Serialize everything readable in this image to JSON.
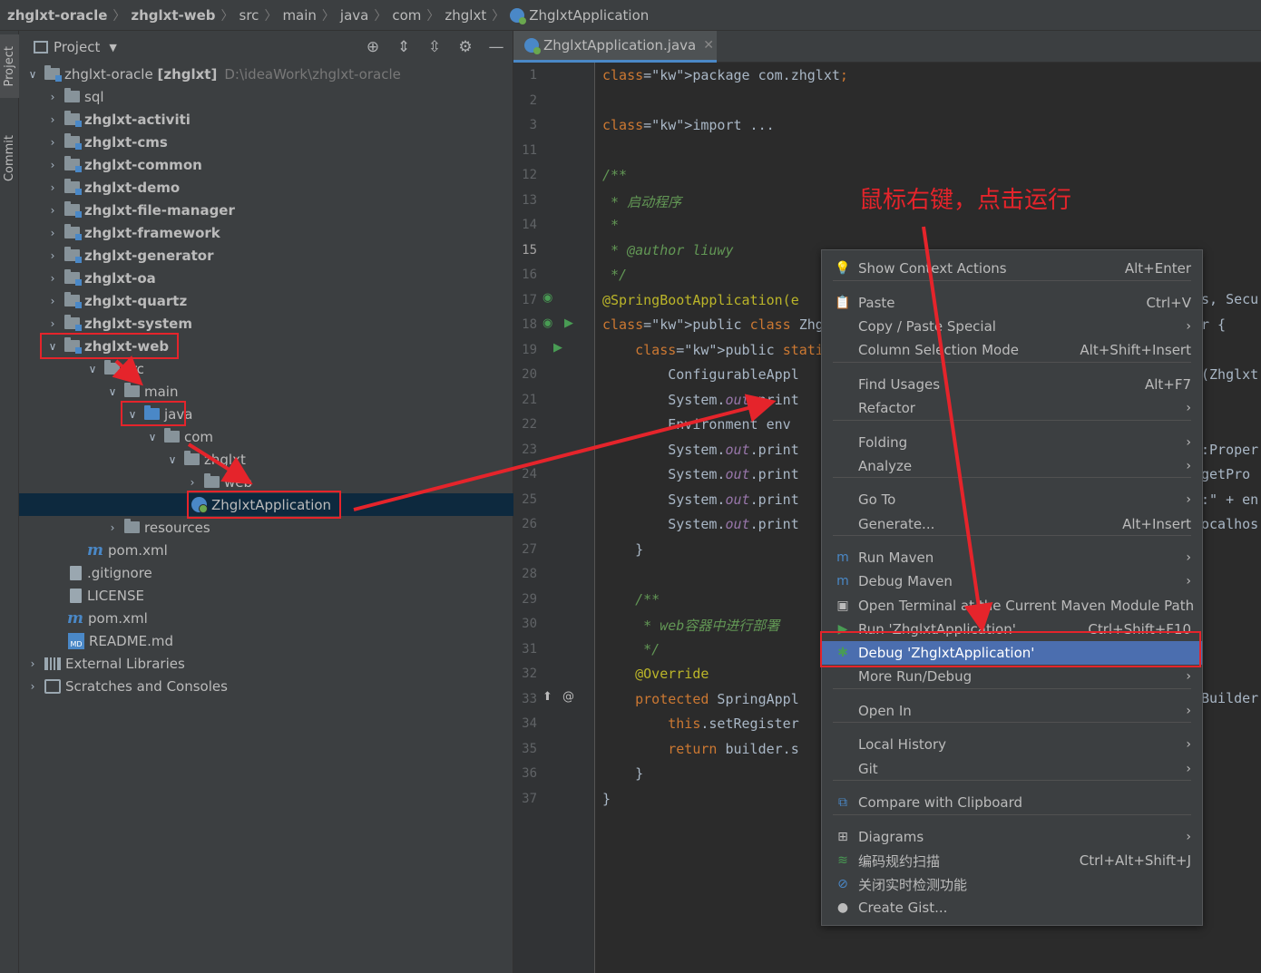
{
  "breadcrumb": {
    "items": [
      "zhglxt-oracle",
      "zhglxt-web",
      "src",
      "main",
      "java",
      "com",
      "zhglxt",
      "ZhglxtApplication"
    ]
  },
  "toolstrip": {
    "project": "Project",
    "commit": "Commit"
  },
  "panel": {
    "title": "Project",
    "root": {
      "name": "zhglxt-oracle",
      "module": "[zhglxt]",
      "path": "D:\\ideaWork\\zhglxt-oracle"
    },
    "modules": [
      "sql",
      "zhglxt-activiti",
      "zhglxt-cms",
      "zhglxt-common",
      "zhglxt-demo",
      "zhglxt-file-manager",
      "zhglxt-framework",
      "zhglxt-generator",
      "zhglxt-oa",
      "zhglxt-quartz",
      "zhglxt-system",
      "zhglxt-web"
    ],
    "web_tree": {
      "src": "src",
      "main": "main",
      "java": "java",
      "com": "com",
      "zhglxt": "zhglxt",
      "web": "web",
      "app": "ZhglxtApplication",
      "resources": "resources",
      "pom": "pom.xml"
    },
    "root_files": [
      ".gitignore",
      "LICENSE",
      "pom.xml",
      "README.md"
    ],
    "external": "External Libraries",
    "scratches": "Scratches and Consoles"
  },
  "editor": {
    "tab": "ZhglxtApplication.java",
    "current_line": "15",
    "lines": [
      {
        "n": "1",
        "t": "package com.zhglxt;"
      },
      {
        "n": "2",
        "t": ""
      },
      {
        "n": "3",
        "t": "import ..."
      },
      {
        "n": "11",
        "t": ""
      },
      {
        "n": "12",
        "t": "/**"
      },
      {
        "n": "13",
        "t": " * 启动程序"
      },
      {
        "n": "14",
        "t": " *"
      },
      {
        "n": "15",
        "t": " * @author liuwy"
      },
      {
        "n": "16",
        "t": " */"
      },
      {
        "n": "17",
        "t": "@SpringBootApplication(e"
      },
      {
        "n": "18",
        "t": "public class ZhglxtAppli"
      },
      {
        "n": "19",
        "t": "    public static void m"
      },
      {
        "n": "20",
        "t": "        ConfigurableAppl"
      },
      {
        "n": "21",
        "t": "        System.out.print"
      },
      {
        "n": "22",
        "t": "        Environment env"
      },
      {
        "n": "23",
        "t": "        System.out.print"
      },
      {
        "n": "24",
        "t": "        System.out.print"
      },
      {
        "n": "25",
        "t": "        System.out.print"
      },
      {
        "n": "26",
        "t": "        System.out.print"
      },
      {
        "n": "27",
        "t": "    }"
      },
      {
        "n": "28",
        "t": ""
      },
      {
        "n": "29",
        "t": "    /**"
      },
      {
        "n": "30",
        "t": "     * web容器中进行部署"
      },
      {
        "n": "31",
        "t": "     */"
      },
      {
        "n": "32",
        "t": "    @Override"
      },
      {
        "n": "33",
        "t": "    protected SpringAppl"
      },
      {
        "n": "34",
        "t": "        this.setRegister"
      },
      {
        "n": "35",
        "t": "        return builder.s"
      },
      {
        "n": "36",
        "t": "    }"
      },
      {
        "n": "37",
        "t": "}"
      }
    ],
    "right_fragments": [
      "s, Secu",
      "r {",
      "(Zhglxt",
      ":Proper",
      "getPro",
      ":\" + en",
      "ocalhos",
      "Builder"
    ]
  },
  "annotation": "鼠标右键，点击运行",
  "context_menu": {
    "items": [
      {
        "label": "Show Context Actions",
        "shortcut": "Alt+Enter",
        "icon": "lightbulb-icon"
      },
      {
        "label": "Paste",
        "shortcut": "Ctrl+V",
        "icon": "clipboard-icon"
      },
      {
        "label": "Copy / Paste Special",
        "shortcut": "",
        "submenu": true
      },
      {
        "label": "Column Selection Mode",
        "shortcut": "Alt+Shift+Insert"
      },
      {
        "label": "Find Usages",
        "shortcut": "Alt+F7"
      },
      {
        "label": "Refactor",
        "shortcut": "",
        "submenu": true
      },
      {
        "label": "Folding",
        "shortcut": "",
        "submenu": true
      },
      {
        "label": "Analyze",
        "shortcut": "",
        "submenu": true
      },
      {
        "label": "Go To",
        "shortcut": "",
        "submenu": true
      },
      {
        "label": "Generate...",
        "shortcut": "Alt+Insert"
      },
      {
        "label": "Run Maven",
        "shortcut": "",
        "submenu": true,
        "icon": "maven-run-icon"
      },
      {
        "label": "Debug Maven",
        "shortcut": "",
        "submenu": true,
        "icon": "maven-debug-icon"
      },
      {
        "label": "Open Terminal at the Current Maven Module Path",
        "shortcut": "",
        "icon": "terminal-icon"
      },
      {
        "label": "Run 'ZhglxtApplication'",
        "shortcut": "Ctrl+Shift+F10",
        "icon": "run-icon"
      },
      {
        "label": "Debug 'ZhglxtApplication'",
        "shortcut": "",
        "icon": "debug-icon",
        "highlighted": true
      },
      {
        "label": "More Run/Debug",
        "shortcut": "",
        "submenu": true
      },
      {
        "label": "Open In",
        "shortcut": "",
        "submenu": true
      },
      {
        "label": "Local History",
        "shortcut": "",
        "submenu": true
      },
      {
        "label": "Git",
        "shortcut": "",
        "submenu": true
      },
      {
        "label": "Compare with Clipboard",
        "shortcut": "",
        "icon": "compare-icon"
      },
      {
        "label": "Diagrams",
        "shortcut": "",
        "submenu": true,
        "icon": "diagram-icon"
      },
      {
        "label": "编码规约扫描",
        "shortcut": "Ctrl+Alt+Shift+J",
        "icon": "scan-icon"
      },
      {
        "label": "关闭实时检测功能",
        "shortcut": "",
        "icon": "disable-icon"
      },
      {
        "label": "Create Gist...",
        "shortcut": "",
        "icon": "github-icon"
      }
    ]
  },
  "colors": {
    "accent": "#4b6eaf",
    "annotation_red": "#e5242b",
    "keyword": "#cc7832",
    "comment": "#629755"
  }
}
